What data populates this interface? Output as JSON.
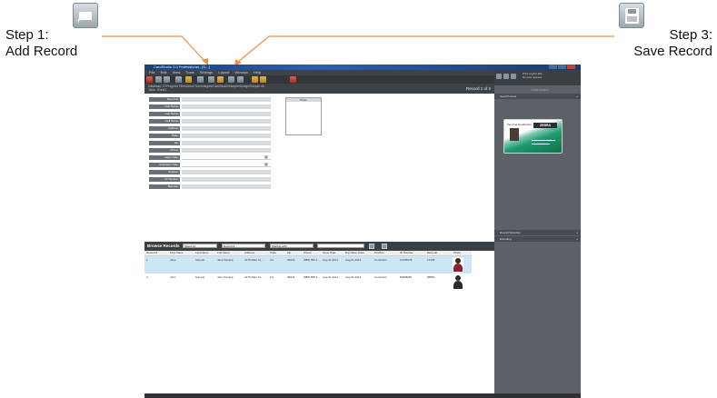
{
  "callouts": {
    "step1": {
      "line1": "Step 1:",
      "line2": "Add Record",
      "icon": "add-record-icon"
    },
    "step3": {
      "line1": "Step 3:",
      "line2": "Save Record",
      "icon": "save-record-icon"
    },
    "leader_color": "#f0923a"
  },
  "app": {
    "title": "CardStudio 2.0 Professional - [D...]",
    "menu": [
      "File",
      "Edit",
      "View",
      "Tools",
      "Settings",
      "Layout",
      "Window",
      "Help"
    ],
    "path_line1": "Database: C:\\Program Files\\Zebra Technologies\\CardStudio\\Sample\\Design\\Sample.db",
    "path_line2": "Table: Sheet1",
    "record_counter": "Record 1 of 2",
    "form_labels": [
      "Record #",
      "First Name",
      "Last Name",
      "Full Name",
      "Address",
      "State",
      "Zip",
      "Phone",
      "Issue Date",
      "Expiration Date",
      "Position",
      "ID Number",
      "Barcode"
    ],
    "photo_label": "Photo",
    "browse": {
      "label": "Browse Records",
      "select_by": "Select by",
      "field": "Record #",
      "match": "Starting with",
      "search_value": ""
    },
    "grid": {
      "headers": [
        "Record #",
        "First Name",
        "Last Name",
        "Full Name",
        "Address",
        "State",
        "Zip",
        "Phone",
        "Issue Date",
        "Expiration Date",
        "Position",
        "ID Number",
        "Barcode",
        "Photo"
      ],
      "rows": [
        [
          "1",
          "Jane",
          "Sample",
          "Jane Sample",
          "2276 Main St., ...",
          "CA",
          "95023",
          "(888) 555-1...",
          "Aug-01-2011",
          "Aug-01-2012",
          "Contractor",
          "12345678",
          "12345"
        ],
        [
          "2",
          "John",
          "Sample",
          "John Sample",
          "2276 Main St., ...",
          "CA",
          "95023",
          "(888) 555-1...",
          "Aug-01-2011",
          "Aug-01-2012",
          "Contractor",
          "80808081",
          "88890"
        ]
      ]
    },
    "side": {
      "header_text_1": "Print engine idle",
      "header_text_2": "No jobs queued",
      "dashboard": "Dashboard",
      "panes": [
        "Card Preview",
        "Record Selection",
        "Encoding"
      ],
      "card_brand": "ZEBRA",
      "card_name": "Personal Identification"
    },
    "accent": "#2b5fae",
    "selected_row_color": "#cde6f5"
  }
}
